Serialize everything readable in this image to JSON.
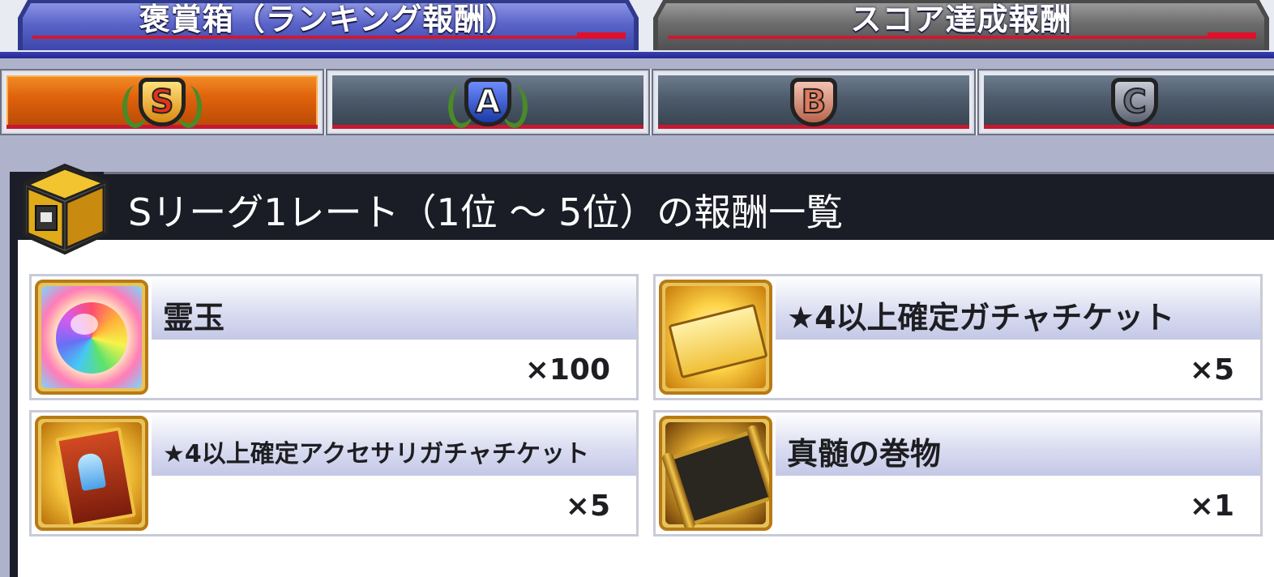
{
  "tabs": {
    "ranking_label": "褒賞箱（ランキング報酬）",
    "score_label": "スコア達成報酬"
  },
  "ranks": [
    {
      "letter": "S",
      "active": true,
      "color": "#e8a020"
    },
    {
      "letter": "A",
      "active": false,
      "color": "#2a4fc0"
    },
    {
      "letter": "B",
      "active": false,
      "color": "#d9826a"
    },
    {
      "letter": "C",
      "active": false,
      "color": "#5a6478"
    }
  ],
  "header": {
    "title": "Sリーグ1レート（1位 ～ 5位）の報酬一覧"
  },
  "rewards": [
    {
      "name": "霊玉",
      "quantity": "×100",
      "icon": "rainbow-orb-icon"
    },
    {
      "name": "★4以上確定ガチャチケット",
      "quantity": "×5",
      "icon": "gacha-ticket-icon"
    },
    {
      "name": "★4以上確定アクセサリガチャチケット",
      "quantity": "×5",
      "icon": "accessory-ticket-icon"
    },
    {
      "name": "真髄の巻物",
      "quantity": "×1",
      "icon": "scroll-icon"
    }
  ]
}
